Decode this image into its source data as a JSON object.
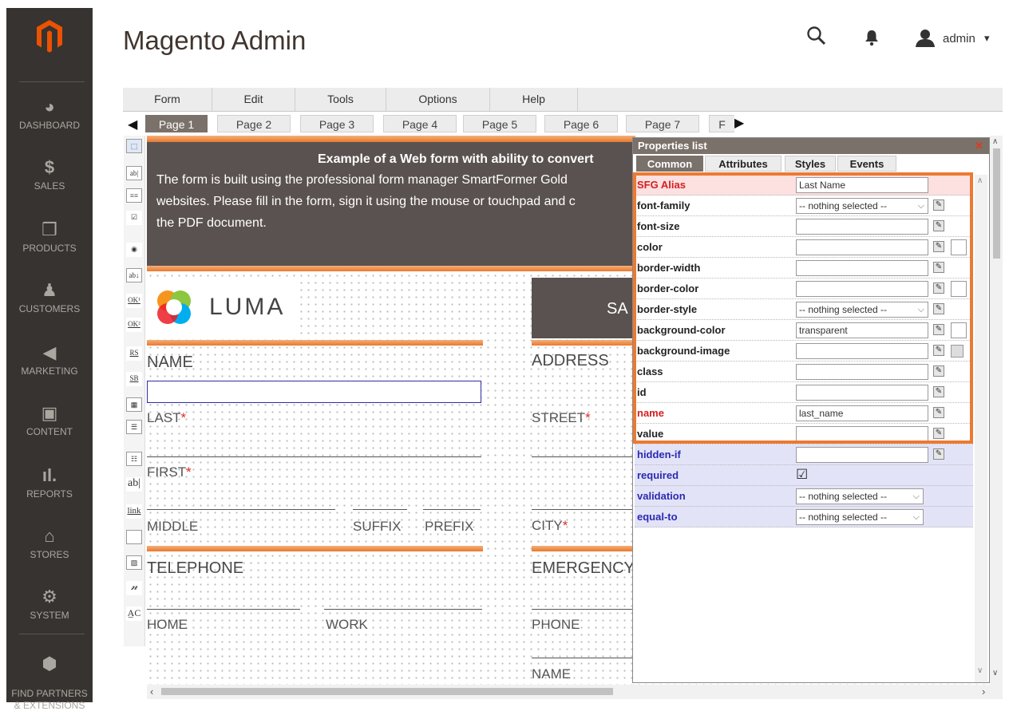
{
  "app_title": "Magento Admin",
  "header": {
    "user": "admin",
    "user_caret": "▾"
  },
  "sidebar": {
    "items": [
      {
        "label": "DASHBOARD",
        "icon": "speedometer-icon"
      },
      {
        "label": "SALES",
        "icon": "dollar-icon"
      },
      {
        "label": "PRODUCTS",
        "icon": "box-icon"
      },
      {
        "label": "CUSTOMERS",
        "icon": "person-icon"
      },
      {
        "label": "MARKETING",
        "icon": "megaphone-icon"
      },
      {
        "label": "CONTENT",
        "icon": "layout-icon"
      },
      {
        "label": "REPORTS",
        "icon": "bar-chart-icon"
      },
      {
        "label": "STORES",
        "icon": "storefront-icon"
      },
      {
        "label": "SYSTEM",
        "icon": "gear-icon"
      },
      {
        "label": "FIND PARTNERS\n& EXTENSIONS",
        "icon": "cube-icon"
      }
    ]
  },
  "menubar": {
    "items": [
      "Form",
      "Edit",
      "Tools",
      "Options",
      "Help"
    ]
  },
  "pages": {
    "items": [
      "Page 1",
      "Page 2",
      "Page 3",
      "Page 4",
      "Page 5",
      "Page 6",
      "Page 7",
      "F"
    ],
    "active": "Page 1"
  },
  "form": {
    "banner_title": "Example of a Web form with ability to convert",
    "banner_text_1": "The form is built using the professional form manager SmartFormer Gold",
    "banner_text_2": "websites. Please fill in the form, sign it using the mouse or touchpad and c",
    "banner_text_3": "the PDF document.",
    "logo_text": "LUMA",
    "right_banner_text": "SA",
    "name_heading": "NAME",
    "address_heading": "ADDRESS",
    "last_label": "LAST",
    "first_label": "FIRST",
    "middle_label": "MIDDLE",
    "suffix_label": "SUFFIX",
    "prefix_label": "PREFIX",
    "street_label": "STREET",
    "city_label": "CITY",
    "telephone_heading": "TELEPHONE",
    "emergency_heading": "EMERGENCY",
    "home_label": "HOME",
    "work_label": "WORK",
    "phone_label": "PHONE",
    "name_label": "NAME",
    "required_mark": "*"
  },
  "properties": {
    "title": "Properties list",
    "tabs": [
      "Common",
      "Attributes",
      "Styles",
      "Events"
    ],
    "active_tab": "Common",
    "rows": [
      {
        "key": "SFG Alias",
        "value": "Last Name"
      },
      {
        "key": "font-family",
        "value": "-- nothing selected --"
      },
      {
        "key": "font-size",
        "value": ""
      },
      {
        "key": "color",
        "value": ""
      },
      {
        "key": "border-width",
        "value": ""
      },
      {
        "key": "border-color",
        "value": ""
      },
      {
        "key": "border-style",
        "value": "-- nothing selected --"
      },
      {
        "key": "background-color",
        "value": "transparent"
      },
      {
        "key": "background-image",
        "value": ""
      },
      {
        "key": "class",
        "value": ""
      },
      {
        "key": "id",
        "value": ""
      },
      {
        "key": "name",
        "value": "last_name"
      },
      {
        "key": "value",
        "value": ""
      },
      {
        "key": "hidden-if",
        "value": ""
      },
      {
        "key": "required",
        "value": "☑"
      },
      {
        "key": "validation",
        "value": "-- nothing selected --"
      },
      {
        "key": "equal-to",
        "value": "-- nothing selected --"
      }
    ]
  },
  "colors": {
    "accent": "#eb7a32",
    "sidebar": "#373330",
    "brand": "#eb5202"
  }
}
